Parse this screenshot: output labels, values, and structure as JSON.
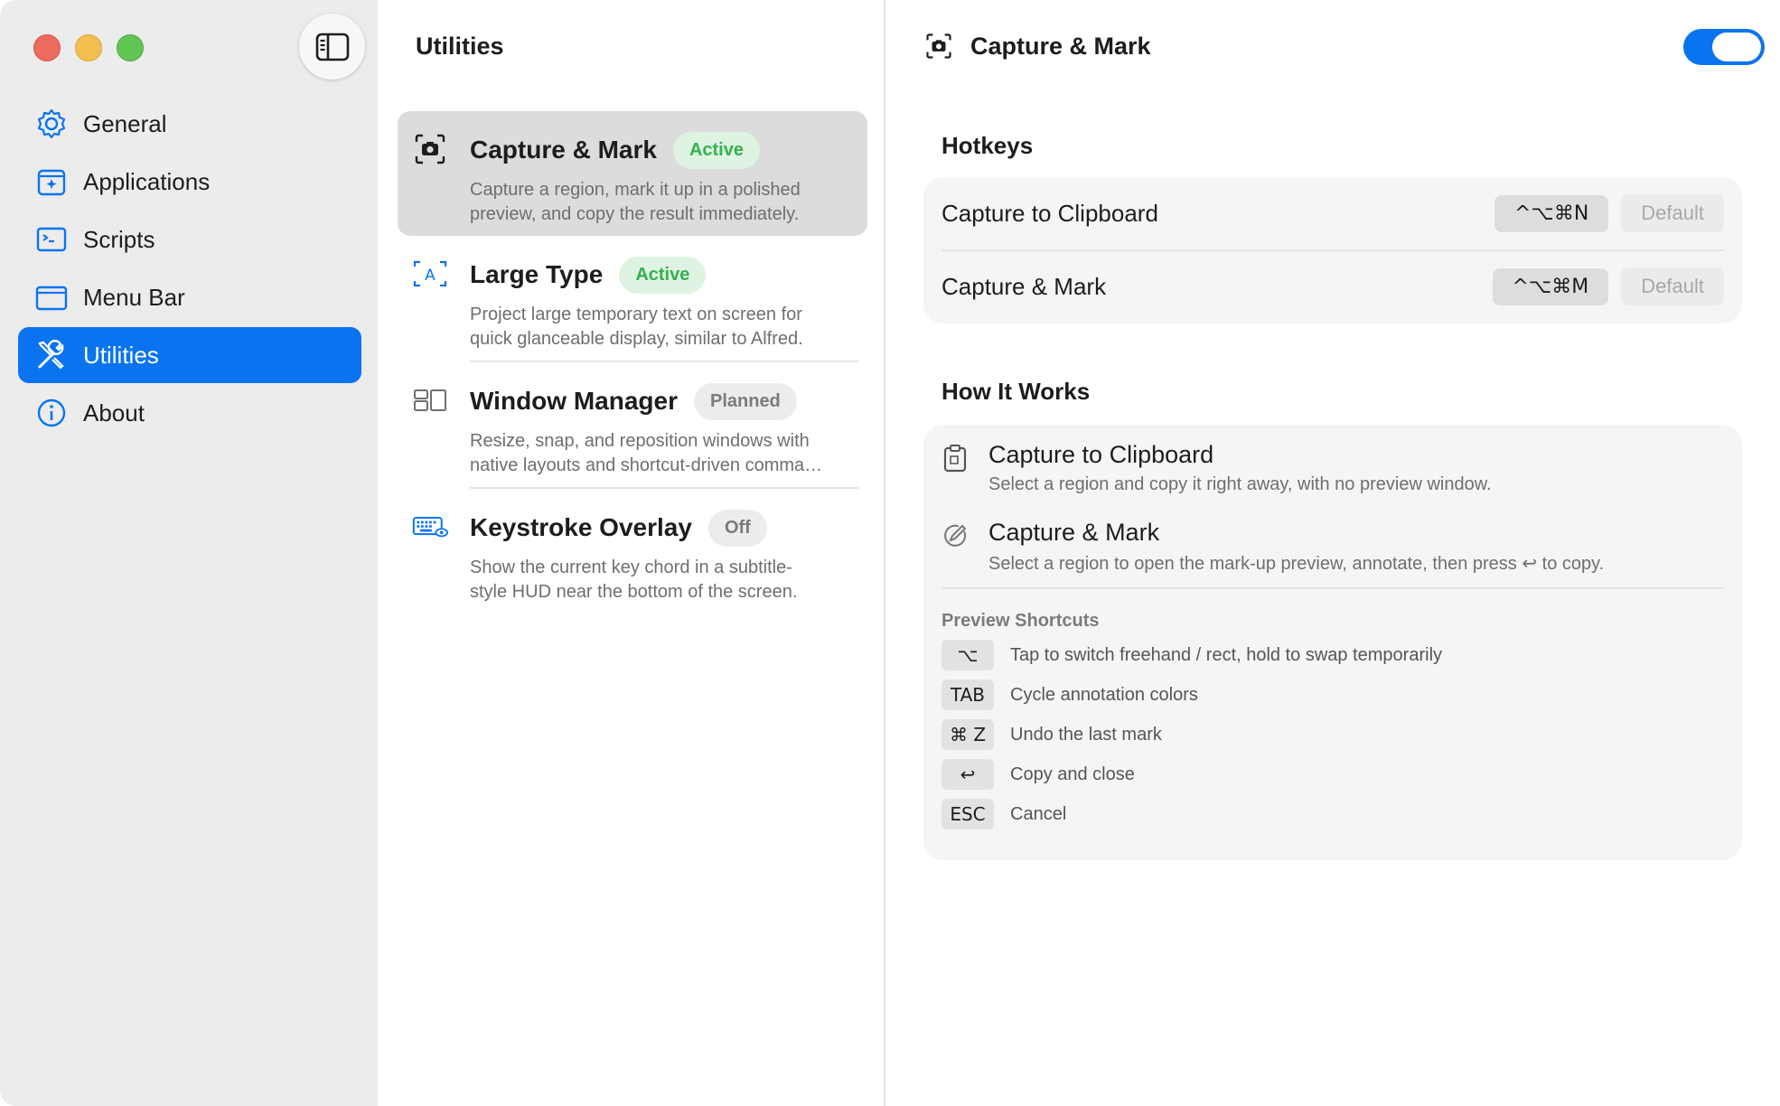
{
  "sidebar": {
    "items": [
      {
        "label": "General",
        "icon": "gear-icon"
      },
      {
        "label": "Applications",
        "icon": "applications-icon"
      },
      {
        "label": "Scripts",
        "icon": "terminal-icon"
      },
      {
        "label": "Menu Bar",
        "icon": "menubar-icon"
      },
      {
        "label": "Utilities",
        "icon": "tools-icon",
        "active": true
      },
      {
        "label": "About",
        "icon": "info-icon"
      }
    ]
  },
  "middle": {
    "title": "Utilities",
    "utilities": [
      {
        "name": "Capture & Mark",
        "badge": "Active",
        "desc1": "Capture a region, mark it up in a polished",
        "desc2": "preview, and copy the result immediately."
      },
      {
        "name": "Large Type",
        "badge": "Active",
        "desc1": "Project large temporary text on screen for",
        "desc2": "quick glanceable display, similar to Alfred."
      },
      {
        "name": "Window Manager",
        "badge": "Planned",
        "desc1": "Resize, snap, and reposition windows with",
        "desc2": "native layouts and shortcut-driven comma…"
      },
      {
        "name": "Keystroke Overlay",
        "badge": "Off",
        "desc1": "Show the current key chord in a subtitle-",
        "desc2": "style HUD near the bottom of the screen."
      }
    ]
  },
  "detail": {
    "title": "Capture & Mark",
    "hotkeys_title": "Hotkeys",
    "hotkeys": [
      {
        "label": "Capture to Clipboard",
        "combo": "^⌥⌘N",
        "default_label": "Default"
      },
      {
        "label": "Capture & Mark",
        "combo": "^⌥⌘M",
        "default_label": "Default"
      }
    ],
    "how_title": "How It Works",
    "how": [
      {
        "title": "Capture to Clipboard",
        "desc": "Select a region and copy it right away, with no preview window."
      },
      {
        "title": "Capture & Mark",
        "desc": "Select a region to open the mark-up preview, annotate, then press ↩ to copy."
      }
    ],
    "preview_shortcuts_title": "Preview Shortcuts",
    "preview_shortcuts": [
      {
        "key": "⌥",
        "desc": "Tap to switch freehand / rect, hold to swap temporarily"
      },
      {
        "key": "TAB",
        "desc": "Cycle annotation colors"
      },
      {
        "key": "⌘ Z",
        "desc": "Undo the last mark"
      },
      {
        "key": "↩",
        "desc": "Copy and close"
      },
      {
        "key": "ESC",
        "desc": "Cancel"
      }
    ]
  },
  "colors": {
    "accent": "#0a74f0",
    "active_badge": "#33b24b"
  }
}
